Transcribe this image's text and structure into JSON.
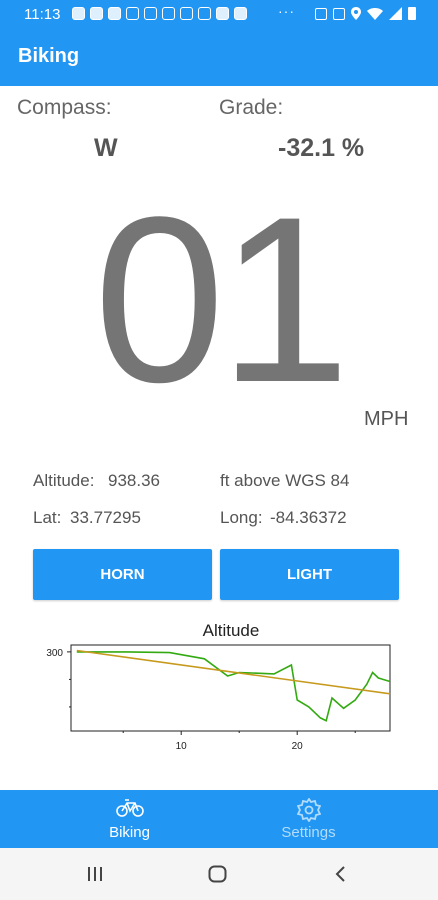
{
  "status_bar": {
    "time": "11:13",
    "overflow": "···"
  },
  "app": {
    "title": "Biking"
  },
  "compass": {
    "label": "Compass:",
    "value": "W"
  },
  "grade": {
    "label": "Grade:",
    "value": "-32.1 %"
  },
  "speed": {
    "value": "01",
    "unit": "MPH"
  },
  "altitude": {
    "label": "Altitude:",
    "value": "938.36",
    "unit": "ft above WGS 84"
  },
  "lat": {
    "label": "Lat:",
    "value": "33.77295"
  },
  "long": {
    "label": "Long:",
    "value": "-84.36372"
  },
  "buttons": {
    "horn": "HORN",
    "light": "LIGHT"
  },
  "chart_data": {
    "type": "line",
    "title": "Altitude",
    "xlabel": "",
    "ylabel": "",
    "x_ticks": [
      "10",
      "20"
    ],
    "y_ticks": [
      "300"
    ],
    "xlim": [
      0.5,
      28
    ],
    "ylim": [
      185,
      310
    ],
    "series": [
      {
        "color": "#33aa11",
        "x": [
          1,
          5,
          9,
          12,
          14,
          15,
          18,
          19.5,
          20,
          21,
          22,
          22.5,
          23,
          24,
          25,
          26,
          26.5,
          27,
          28
        ],
        "y": [
          300,
          300,
          299,
          290,
          265,
          270,
          268,
          281,
          230,
          220,
          204,
          200,
          233,
          218,
          230,
          253,
          270,
          262,
          257
        ]
      },
      {
        "color": "#c79a1e",
        "x": [
          1,
          28
        ],
        "y": [
          302,
          239
        ]
      }
    ]
  },
  "tabs": [
    {
      "label": "Biking",
      "icon": "bicycle-icon",
      "active": true
    },
    {
      "label": "Settings",
      "icon": "gear-icon",
      "active": false
    }
  ],
  "colors": {
    "primary": "#2196f3",
    "active_tab": "#ffffff",
    "inactive_tab": "#b3dcfb"
  }
}
